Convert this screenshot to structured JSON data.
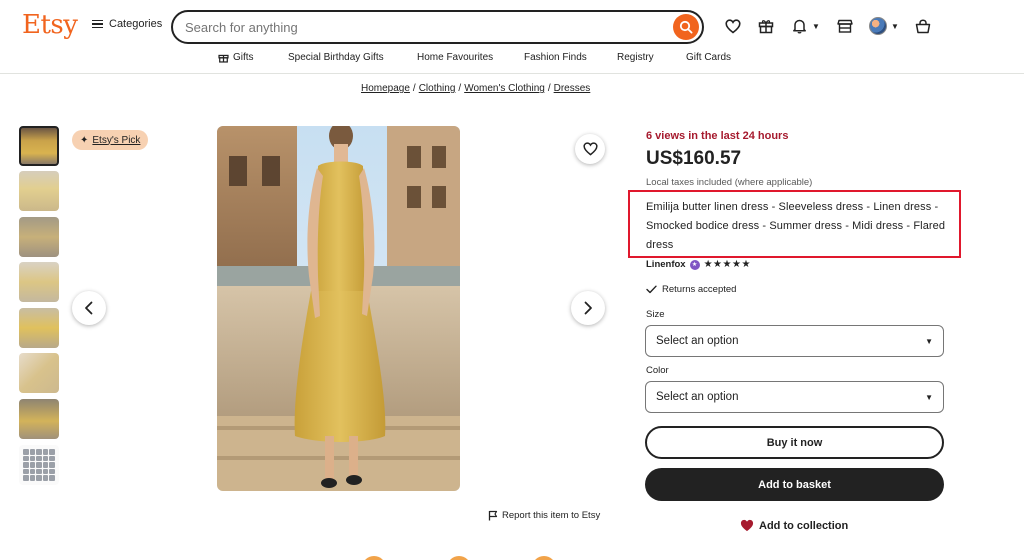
{
  "header": {
    "logo": "Etsy",
    "categories_label": "Categories",
    "search_placeholder": "Search for anything"
  },
  "nav": {
    "items": [
      {
        "label": "Gifts"
      },
      {
        "label": "Special Birthday Gifts"
      },
      {
        "label": "Home Favourites"
      },
      {
        "label": "Fashion Finds"
      },
      {
        "label": "Registry"
      },
      {
        "label": "Gift Cards"
      }
    ]
  },
  "breadcrumb": {
    "items": [
      "Homepage",
      "Clothing",
      "Women's Clothing",
      "Dresses"
    ],
    "separator": "/"
  },
  "gallery": {
    "badge": "Etsy's Pick",
    "thumbnail_count": 8,
    "active_index": 0
  },
  "listing": {
    "views": "6 views in the last 24 hours",
    "price": "US$160.57",
    "tax_note": "Local taxes included (where applicable)",
    "title": "Emilija butter linen dress - Sleeveless dress - Linen dress - Smocked bodice dress - Summer dress - Midi dress - Flared dress",
    "shop_name": "Linenfox",
    "stars": "★★★★★",
    "returns": "Returns accepted",
    "size_label": "Size",
    "size_value": "Select an option",
    "color_label": "Color",
    "color_value": "Select an option",
    "buy_now": "Buy it now",
    "add_to_basket": "Add to basket",
    "add_to_collection": "Add to collection",
    "report": "Report this item to Etsy"
  },
  "colors": {
    "brand": "#f1641e",
    "views": "#a61a2e",
    "highlight": "#e0182d",
    "dark_button": "#222222"
  }
}
